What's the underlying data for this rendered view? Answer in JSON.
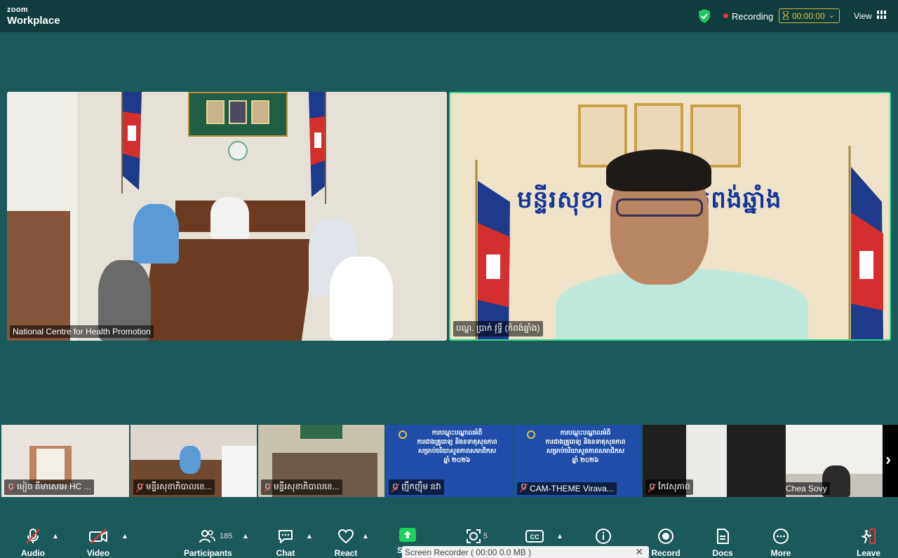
{
  "app": {
    "brand_top": "zoom",
    "brand_bottom": "Workplace"
  },
  "topbar": {
    "recording_label": "Recording",
    "timer": "00:00:00",
    "view_label": "View"
  },
  "main_videos": [
    {
      "name": "National Centre for Health Promotion"
    },
    {
      "name": "បណ្ឌ. ប្រាក់ វុទ្ធី (កំពង់ឆ្នាំង)",
      "banner": "មន្ទីរសុខា",
      "banner_suffix": "កំពង់ឆ្នាំង"
    }
  ],
  "thumbnails": [
    {
      "name": "មៀច គឹមាសេអេ HC ..."
    },
    {
      "name": "មន្ទីរសុខាភិបាលខេ..."
    },
    {
      "name": "មន្ទីរសុខាភិបាលខេ..."
    },
    {
      "name": "ញឹកញ៉ឹម នវា",
      "card_lines": [
        "ការបណ្ដុះបណ្ដាលអំពី",
        "ការជាងគ្រូពេទ្យ និងខទាតុសុខភាព",
        "សម្រាប់ចរិយាសួខភាពសមាជិកស",
        "ឆ្នាំ ២០២៦"
      ]
    },
    {
      "name": "CAM-THEME Virava...",
      "card_lines": [
        "ការបណ្ដុះបណ្ដាលអំពី",
        "ការជាងគ្រូពេទ្យ និងខទាតុសុខភាព",
        "សម្រាប់ចរិយាសួខភាពសមាជិកស",
        "ឆ្នាំ ២០២៦"
      ]
    },
    {
      "name": "កែវសុភាព"
    },
    {
      "name": "Chea Sovy"
    }
  ],
  "toolbar": {
    "audio": "Audio",
    "video": "Video",
    "participants": "Participants",
    "participants_count": "185",
    "chat": "Chat",
    "react": "React",
    "share": "S",
    "apps_count": "5",
    "record": "Record",
    "docs": "Docs",
    "more": "More",
    "leave": "Leave"
  },
  "recorder": {
    "label": "Screen Recorder ( 00:00   0.0 MB )"
  },
  "colors": {
    "background": "#1b5a5a",
    "topbar": "#0f3d3e",
    "active_speaker_border": "#35d98c",
    "recording_dot": "#e53935",
    "timer_accent": "#e5c14a",
    "share_green": "#19d35c"
  }
}
